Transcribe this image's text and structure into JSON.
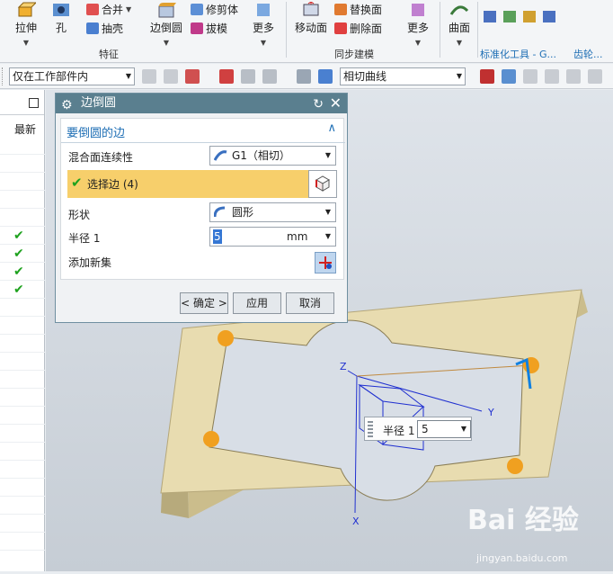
{
  "ribbon": {
    "buttons": [
      "拉伸",
      "孔",
      "边倒圆",
      "更多",
      "移动面",
      "更多",
      "曲面"
    ],
    "small_items": [
      "合并",
      "抽壳",
      "修剪体",
      "拔模",
      "替换面",
      "删除面"
    ],
    "groups": [
      "特征",
      "同步建模",
      "标准化工具 - G...",
      "齿轮..."
    ]
  },
  "toolbar2": {
    "filter_combo": "仅在工作部件内",
    "curve_rule_combo": "相切曲线"
  },
  "left_panel": {
    "column_header": "最新",
    "check_glyph": "✔"
  },
  "dialog": {
    "title": "边倒圆",
    "section_title": "要倒圆的边",
    "continuity_label": "混合面连续性",
    "continuity_value": "G1（相切）",
    "select_edge_label": "选择边 (4)",
    "shape_label": "形状",
    "shape_value": "圆形",
    "radius_label": "半径 1",
    "radius_value": "5",
    "radius_unit": "mm",
    "add_set_label": "添加新集",
    "ok_label": "< 确定 >",
    "apply_label": "应用",
    "cancel_label": "取消"
  },
  "viewport": {
    "axis_x": "X",
    "axis_y": "Y",
    "axis_z": "Z",
    "onscreen_label": "半径 1",
    "onscreen_value": "5"
  },
  "watermark": {
    "brand": "Bai 经验",
    "url": "jingyan.baidu.com"
  },
  "colors": {
    "dialog_title_bg": "#5a7f8f",
    "selection_highlight": "#f7cf6b",
    "section_title": "#1f6fb5",
    "plate": "#e8dcb0",
    "csys": "#2030d0",
    "edge_marker": "#f0a020"
  }
}
